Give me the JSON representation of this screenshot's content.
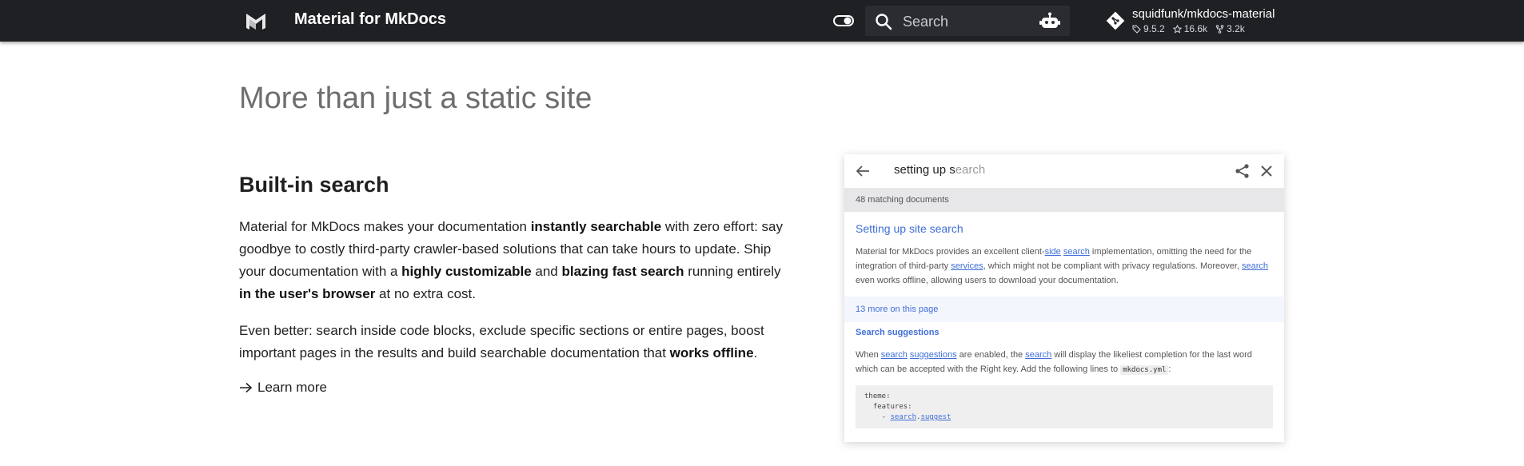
{
  "header": {
    "title": "Material for MkDocs",
    "search_placeholder": "Search",
    "repo": {
      "name": "squidfunk/mkdocs-material",
      "version": "9.5.2",
      "stars": "16.6k",
      "forks": "3.2k"
    }
  },
  "main": {
    "section_title": "More than just a static site",
    "feature_title": "Built-in search",
    "p1": {
      "t1": "Material for MkDocs makes your documentation ",
      "b1": "instantly searchable",
      "t2": " with zero effort: say goodbye to costly third-party crawler-based solutions that can take hours to update. Ship your documentation with a ",
      "b2": "highly customizable",
      "t3": " and ",
      "b3": "blazing fast search",
      "t4": " running entirely ",
      "b4": "in the user's browser",
      "t5": " at no extra cost."
    },
    "p2": {
      "t1": "Even better: search inside code blocks, exclude specific sections or entire pages, boost important pages in the results and build searchable documentation that ",
      "b1": "works offline",
      "t2": "."
    },
    "learn_more": "Learn more"
  },
  "preview": {
    "query_typed": "setting up s",
    "query_ghost": "earch",
    "meta": "48 matching documents",
    "result1": {
      "title": "Setting up site search",
      "t1": "Material for MkDocs provides an excellent client-",
      "l1": "side",
      "l2": "search",
      "t2": " implementation, omitting the need for the integration of third-party ",
      "l3": "services",
      "t3": ", which might not be compliant with privacy regulations. Moreover, ",
      "l4": "search",
      "t4": " even works offline, allowing users to download your documentation."
    },
    "more": "13 more on this page",
    "result2": {
      "title": "Search suggestions",
      "t1": "When ",
      "l1": "search",
      "l2": "suggestions",
      "t2": " are enabled, the ",
      "l3": "search",
      "t3": " will display the likeliest completion for the last word which can be accepted with the Right key. Add the following lines to ",
      "code": "mkdocs.yml",
      "t4": ":"
    },
    "code": {
      "line1": "theme:",
      "line2": "  features:",
      "line3_prefix": "    - ",
      "line3_a": "search",
      "line3_dot": ".",
      "line3_b": "suggest"
    }
  }
}
